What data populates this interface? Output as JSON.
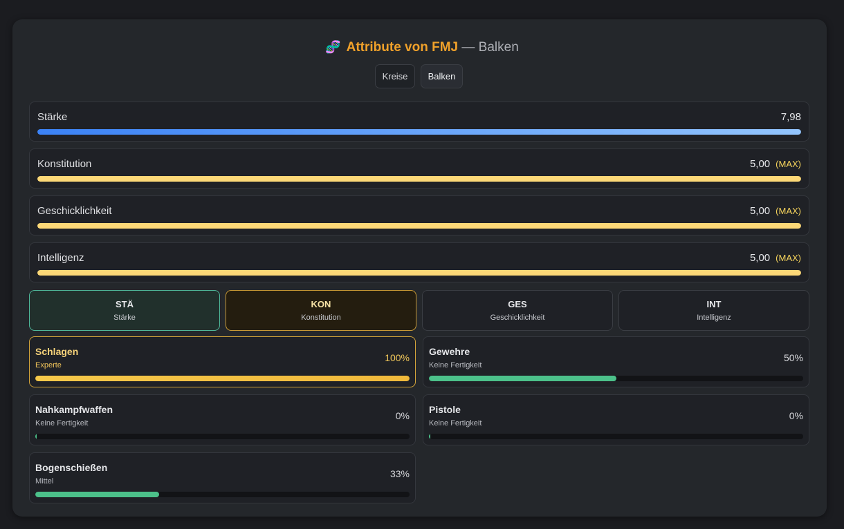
{
  "header": {
    "icon": "dna-icon",
    "icon_glyph": "🧬",
    "title": "Attribute von FMJ",
    "separator": " — Balken"
  },
  "view_toggle": {
    "kreise_label": "Kreise",
    "balken_label": "Balken",
    "selected": "Balken"
  },
  "attributes": [
    {
      "name": "Stärke",
      "value": "7,98",
      "max_label": "",
      "fraction": 1.0,
      "color": "#3b82f6"
    },
    {
      "name": "Konstitution",
      "value": "5,00",
      "max_label": "(MAX)",
      "fraction": 1.0,
      "color": "#fcd877"
    },
    {
      "name": "Geschicklichkeit",
      "value": "5,00",
      "max_label": "(MAX)",
      "fraction": 1.0,
      "color": "#fcd877"
    },
    {
      "name": "Intelligenz",
      "value": "5,00",
      "max_label": "(MAX)",
      "fraction": 1.0,
      "color": "#fcd877"
    }
  ],
  "tabs": [
    {
      "abbr": "STÄ",
      "full": "Stärke"
    },
    {
      "abbr": "KON",
      "full": "Konstitution"
    },
    {
      "abbr": "GES",
      "full": "Geschicklichkeit"
    },
    {
      "abbr": "INT",
      "full": "Intelligenz"
    }
  ],
  "active_tab": "KON",
  "skills": [
    {
      "name": "Schlagen",
      "level": "Experte",
      "percent": "100%",
      "fraction": 1.0,
      "color": "#f5c84a"
    },
    {
      "name": "Gewehre",
      "level": "Keine Fertigkeit",
      "percent": "50%",
      "fraction": 0.5,
      "color": "#4cc18a"
    },
    {
      "name": "Nahkampfwaffen",
      "level": "Keine Fertigkeit",
      "percent": "0%",
      "fraction": 0.0,
      "color": "#4cc18a"
    },
    {
      "name": "Pistole",
      "level": "Keine Fertigkeit",
      "percent": "0%",
      "fraction": 0.0,
      "color": "#4cc18a"
    },
    {
      "name": "Bogenschießen",
      "level": "Mittel",
      "percent": "33%",
      "fraction": 0.33,
      "color": "#4cc18a"
    }
  ]
}
